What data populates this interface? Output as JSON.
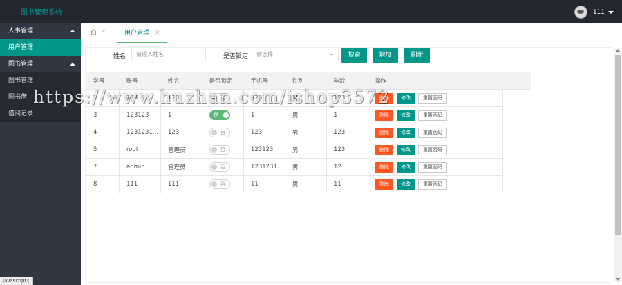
{
  "app": {
    "title": "图书管理系统"
  },
  "user": {
    "name": "111"
  },
  "sidebar": {
    "groups": [
      {
        "label": "人事管理",
        "items": [
          {
            "label": "用户管理",
            "active": true
          }
        ]
      },
      {
        "label": "图书管理",
        "items": [
          {
            "label": "图书管理"
          },
          {
            "label": "图书借"
          },
          {
            "label": "借阅记录"
          }
        ]
      }
    ]
  },
  "tabs": {
    "active_label": "用户管理"
  },
  "filters": {
    "name_label": "姓名",
    "name_placeholder": "请输入姓名",
    "locked_label": "是否锁定",
    "locked_placeholder": "请选择",
    "search_button": "搜索",
    "add_button": "增加",
    "refresh_button": "刷新"
  },
  "table": {
    "headers": [
      "学号",
      "账号",
      "姓名",
      "是否锁定",
      "手机号",
      "性别",
      "年龄",
      "操作"
    ],
    "rows": [
      {
        "id": "2",
        "account": "123",
        "name": "123",
        "locked": false,
        "phone": "123",
        "gender": "男",
        "age": "123"
      },
      {
        "id": "3",
        "account": "123123",
        "name": "1",
        "locked": true,
        "phone": "1",
        "gender": "男",
        "age": "1"
      },
      {
        "id": "4",
        "account": "1231231...",
        "name": "123",
        "locked": false,
        "phone": "123",
        "gender": "男",
        "age": "123"
      },
      {
        "id": "5",
        "account": "root",
        "name": "管理员",
        "locked": false,
        "phone": "123123",
        "gender": "男",
        "age": "123"
      },
      {
        "id": "7",
        "account": "admin",
        "name": "管理员",
        "locked": false,
        "phone": "1231231...",
        "gender": "男",
        "age": "12"
      },
      {
        "id": "8",
        "account": "111",
        "name": "111",
        "locked": false,
        "phone": "11",
        "gender": "男",
        "age": "11"
      }
    ],
    "switch_on_text": "是",
    "switch_off_text": "否",
    "delete_label": "删除",
    "edit_label": "修改",
    "reset_label": "重置密码"
  },
  "status_bar": {
    "text": "javascript:;"
  },
  "watermark": {
    "text": "https://www.huzhan.com/ishop3572"
  },
  "colors": {
    "primary": "#009688",
    "danger": "#ff5722",
    "switch_on": "#5fb878",
    "topbar": "#23262e",
    "sidebar": "#2f3742"
  }
}
